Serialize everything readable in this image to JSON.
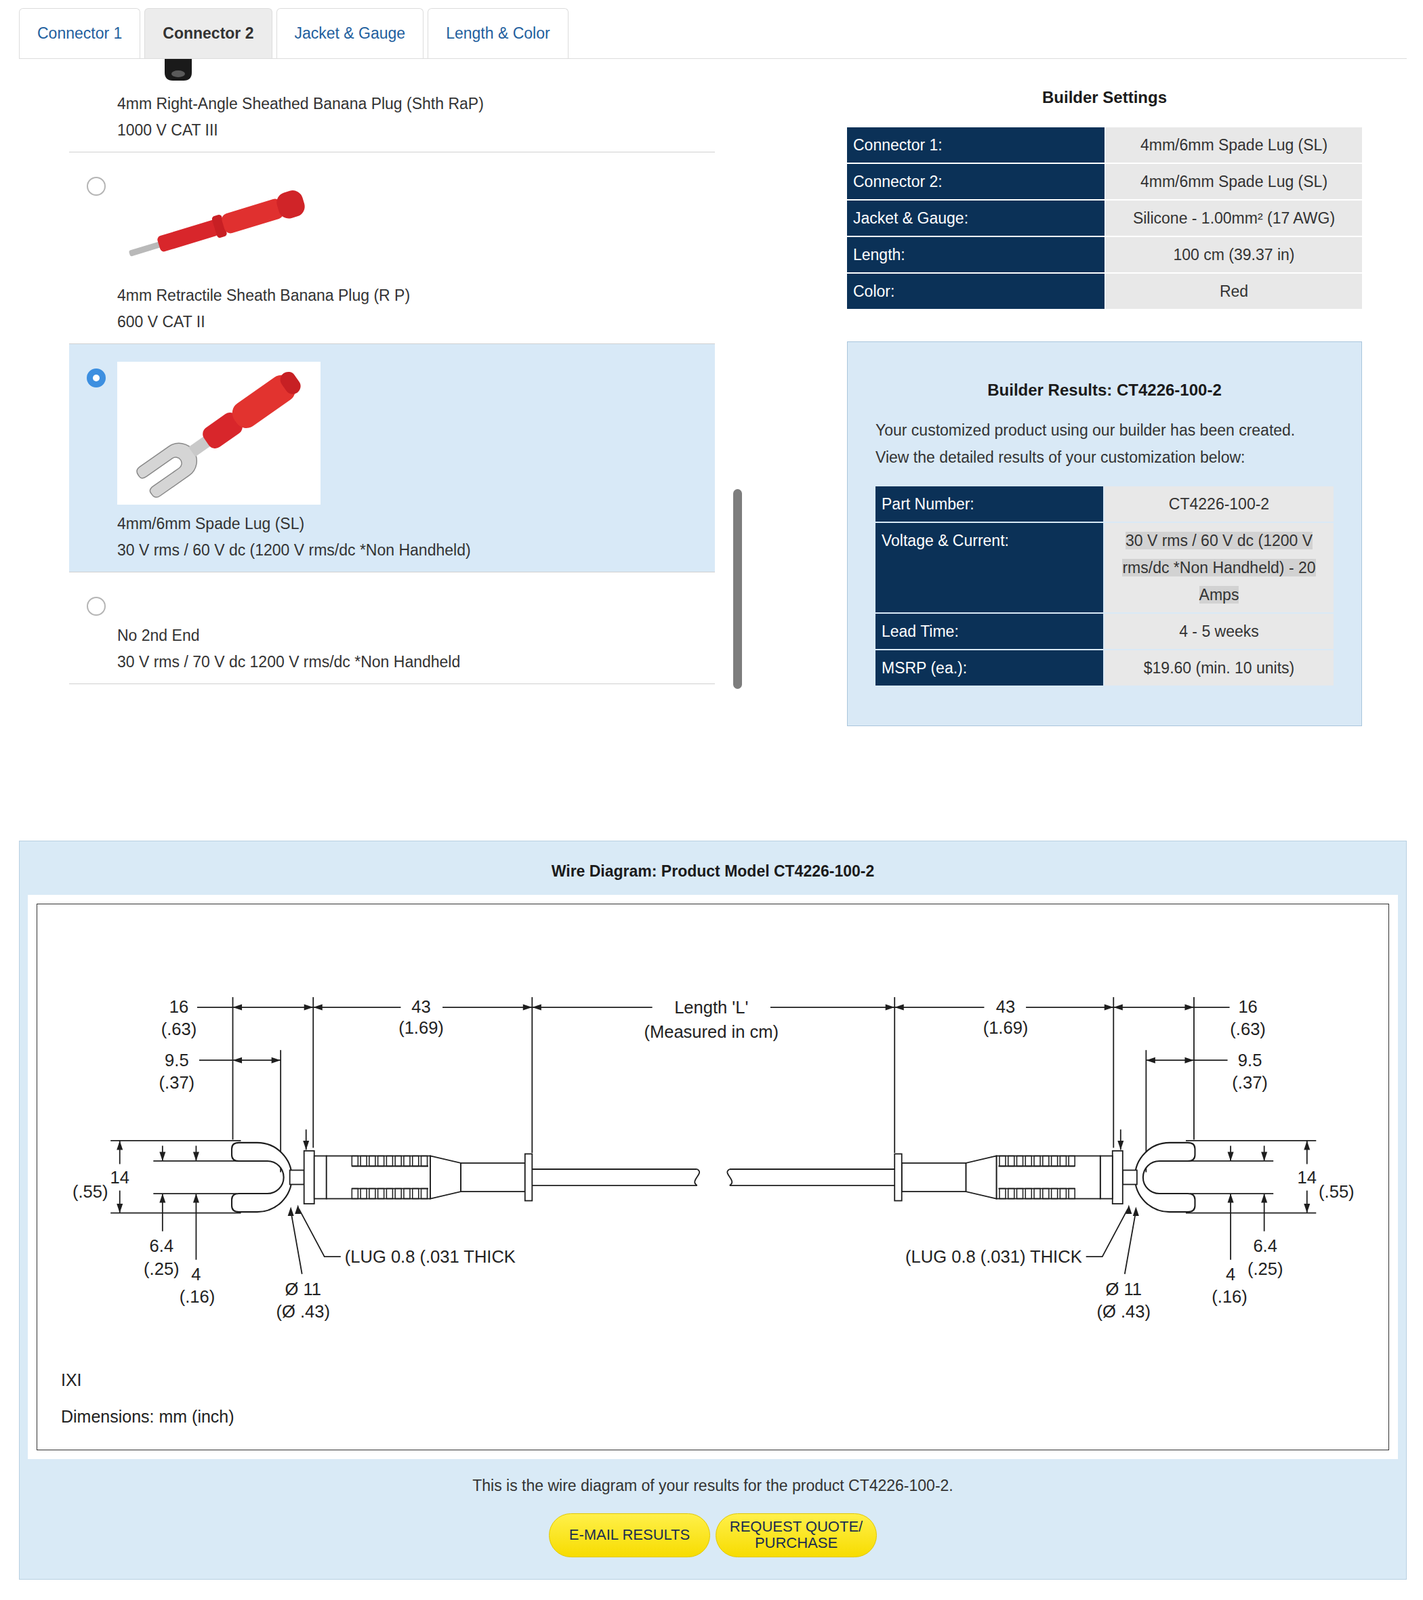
{
  "tabs": [
    {
      "label": "Connector 1",
      "selected": false
    },
    {
      "label": "Connector 2",
      "selected": true
    },
    {
      "label": "Jacket & Gauge",
      "selected": false
    },
    {
      "label": "Length & Color",
      "selected": false
    }
  ],
  "connector_options": [
    {
      "name": "4mm Right-Angle Sheathed Banana Plug (Shth RaP)",
      "rating": "1000 V CAT III",
      "kind": "cropped",
      "selected": false
    },
    {
      "name": "4mm Retractile Sheath Banana Plug (R P)",
      "rating": "600 V CAT II",
      "kind": "banana",
      "selected": false
    },
    {
      "name": "4mm/6mm Spade Lug (SL)",
      "rating": "30 V rms / 60 V dc (1200 V rms/dc *Non Handheld)",
      "kind": "spade",
      "selected": true
    },
    {
      "name": "No 2nd End",
      "rating": "30 V rms / 70 V dc 1200 V rms/dc *Non Handheld",
      "kind": "none",
      "selected": false
    }
  ],
  "options_scrollbar": {
    "level": 0.9
  },
  "builder_settings": {
    "title": "Builder Settings",
    "rows": [
      {
        "label": "Connector 1:",
        "value": "4mm/6mm Spade Lug (SL)"
      },
      {
        "label": "Connector 2:",
        "value": "4mm/6mm Spade Lug (SL)"
      },
      {
        "label": "Jacket & Gauge:",
        "value": "Silicone - 1.00mm² (17 AWG)"
      },
      {
        "label": "Length:",
        "value": "100 cm (39.37 in)"
      },
      {
        "label": "Color:",
        "value": "Red"
      }
    ]
  },
  "builder_results": {
    "title": "Builder Results: CT4226-100-2",
    "intro": [
      "Your customized product using our builder has been created.",
      "View the detailed results of your customization below:"
    ],
    "rows": [
      {
        "label": "Part Number:",
        "lines": [
          "CT4226-100-2"
        ],
        "highlighted": false
      },
      {
        "label": "Voltage & Current:",
        "lines": [
          "30 V rms / 60 V dc (1200 V",
          "rms/dc *Non Handheld) - 20",
          "Amps"
        ],
        "highlighted": true
      },
      {
        "label": "Lead Time:",
        "lines": [
          "4 - 5 weeks"
        ],
        "highlighted": false
      },
      {
        "label": "MSRP (ea.):",
        "lines": [
          "$19.60 (min. 10 units)"
        ],
        "highlighted": false
      }
    ]
  },
  "wire_diagram": {
    "title": "Wire Diagram: Product Model CT4226-100-2",
    "length_label": "Length 'L'",
    "length_note": "(Measured in cm)",
    "ends": [
      {
        "side": "left",
        "overall_mm": "16",
        "overall_in": "(.63)",
        "body_mm": "43",
        "body_in": "(1.69)",
        "slot_depth_mm": "9.5",
        "slot_depth_in": "(.37)",
        "width_mm": "14",
        "width_in": "(.55)",
        "slot_width_mm": "6.4",
        "slot_width_in": "(.25)",
        "stud_mm": "4",
        "stud_in": "(.16)",
        "diameter_mm": "Ø 11",
        "diameter_in": "(Ø .43)",
        "lug_note": "(LUG 0.8 (.031 THICK"
      },
      {
        "side": "right",
        "overall_mm": "16",
        "overall_in": "(.63)",
        "body_mm": "43",
        "body_in": "(1.69)",
        "slot_depth_mm": "9.5",
        "slot_depth_in": "(.37)",
        "width_mm": "14",
        "width_in": "(.55)",
        "slot_width_mm": "6.4",
        "slot_width_in": "(.25)",
        "stud_mm": "4",
        "stud_in": "(.16)",
        "diameter_mm": "Ø 11",
        "diameter_in": "(Ø .43)",
        "lug_note": "(LUG 0.8 (.031) THICK"
      }
    ],
    "maker": "IXI",
    "units_note": "Dimensions: mm (inch)"
  },
  "caption": "This is the wire diagram of your results for the product CT4226-100-2.",
  "buttons": [
    {
      "lines": [
        "E-MAIL RESULTS"
      ]
    },
    {
      "lines": [
        "REQUEST QUOTE/",
        "PURCHASE"
      ]
    }
  ]
}
